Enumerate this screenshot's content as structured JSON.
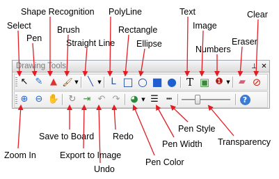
{
  "window": {
    "title": "Drawing Tools",
    "pin_glyph": "⊥",
    "close_glyph": "✕"
  },
  "row1_tools": [
    {
      "name": "select",
      "icon": "arrow-cursor-icon",
      "glyph": "↖"
    },
    {
      "name": "pen",
      "icon": "pen-icon",
      "glyph": "✎"
    },
    {
      "name": "shape-recognition",
      "icon": "shape-recognition-icon",
      "glyph": "▲"
    },
    {
      "name": "brush",
      "icon": "brush-icon",
      "glyph": "🖌"
    },
    {
      "name": "straight-line",
      "icon": "straight-line-icon",
      "glyph": "╲"
    },
    {
      "name": "polyline",
      "icon": "polyline-icon",
      "glyph": "ᒪ"
    },
    {
      "name": "rectangle",
      "icon": "rectangle-icon",
      "glyph": "□"
    },
    {
      "name": "ellipse",
      "icon": "ellipse-icon",
      "glyph": "○"
    },
    {
      "name": "filled-rectangle",
      "icon": "filled-rectangle-icon",
      "glyph": "■"
    },
    {
      "name": "filled-ellipse",
      "icon": "filled-ellipse-icon",
      "glyph": "●"
    },
    {
      "name": "text",
      "icon": "text-icon",
      "glyph": "T"
    },
    {
      "name": "image",
      "icon": "image-icon",
      "glyph": "▣"
    },
    {
      "name": "numbers",
      "icon": "numbers-icon",
      "glyph": "❶"
    },
    {
      "name": "eraser",
      "icon": "eraser-icon",
      "glyph": "▰"
    },
    {
      "name": "clear",
      "icon": "clear-icon",
      "glyph": "⊘"
    }
  ],
  "row2_tools": [
    {
      "name": "zoom-in",
      "icon": "zoom-in-icon",
      "glyph": "⊕"
    },
    {
      "name": "zoom-out",
      "icon": "zoom-out-icon",
      "glyph": "⊖"
    },
    {
      "name": "pan",
      "icon": "hand-icon",
      "glyph": "✋"
    },
    {
      "name": "save-to-board",
      "icon": "save-to-board-icon",
      "glyph": "↻"
    },
    {
      "name": "export-to-image",
      "icon": "export-icon",
      "glyph": "⇥"
    },
    {
      "name": "undo",
      "icon": "undo-icon",
      "glyph": "↶"
    },
    {
      "name": "redo",
      "icon": "redo-icon",
      "glyph": "↷"
    },
    {
      "name": "pen-color",
      "icon": "palette-icon",
      "glyph": "◕"
    },
    {
      "name": "pen-width",
      "icon": "pen-width-icon",
      "glyph": "☰"
    },
    {
      "name": "pen-style",
      "icon": "pen-style-icon",
      "glyph": "┅"
    },
    {
      "name": "help",
      "icon": "help-icon",
      "glyph": "?"
    }
  ],
  "transparency": {
    "level": 0.3
  },
  "labels": {
    "select": "Select",
    "pen": "Pen",
    "shape_recognition": "Shape Recognition",
    "brush": "Brush",
    "straight_line": "Straight Line",
    "polyline": "PolyLine",
    "rectangle": "Rectangle",
    "ellipse": "Ellipse",
    "text": "Text",
    "image": "Image",
    "numbers": "Numbers",
    "eraser": "Eraser",
    "clear": "Clear",
    "zoom_in": "Zoom In",
    "save_to_board": "Save to Board",
    "export_to_image": "Export to Image",
    "undo": "Undo",
    "redo": "Redo",
    "pen_color": "Pen Color",
    "pen_width": "Pen Width",
    "pen_style": "Pen Style",
    "transparency": "Transparency"
  },
  "colors": {
    "annotation": "#e31b23",
    "accent_blue": "#1f5fd0",
    "help_blue": "#3a7bd5"
  }
}
